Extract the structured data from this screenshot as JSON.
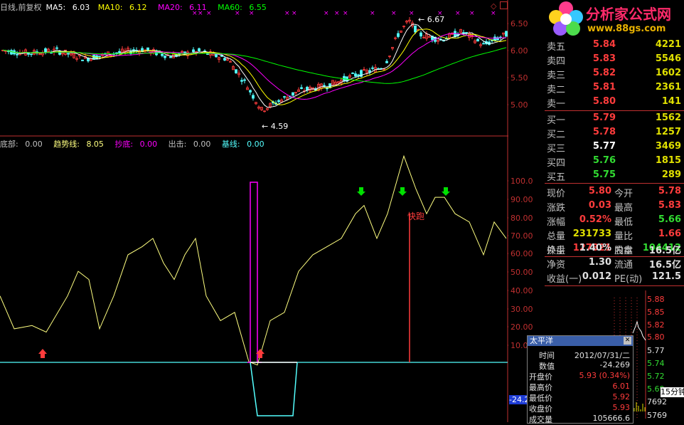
{
  "header": {
    "title": "日线,前复权",
    "ma5_label": "MA5:",
    "ma5": "6.03",
    "ma10_label": "MA10:",
    "ma10": "6.12",
    "ma20_label": "MA20:",
    "ma20": "6.11",
    "ma60_label": "MA60:",
    "ma60": "6.55"
  },
  "price_axis": [
    "6.50",
    "6.00",
    "5.50",
    "5.00"
  ],
  "price_annotations": {
    "high": "6.67",
    "low": "4.59"
  },
  "indicator": {
    "bottom_label": "底部:",
    "bottom": "0.00",
    "trend_label": "趋势线:",
    "trend": "8.05",
    "buy_label": "抄底:",
    "buy": "0.00",
    "sell_label": "出击:",
    "sell": "0.00",
    "base_label": "基线:",
    "base": "0.00",
    "axis": [
      "100.0",
      "90.00",
      "80.00",
      "70.00",
      "60.00",
      "50.00",
      "40.00",
      "30.00",
      "20.00",
      "10.00"
    ],
    "escape_label": "快跑",
    "cursor_value": "-24.2"
  },
  "quote": {
    "asks": [
      {
        "label": "卖五",
        "price": "5.84",
        "vol": "4221"
      },
      {
        "label": "卖四",
        "price": "5.83",
        "vol": "5546"
      },
      {
        "label": "卖三",
        "price": "5.82",
        "vol": "1602"
      },
      {
        "label": "卖二",
        "price": "5.81",
        "vol": "2361"
      },
      {
        "label": "卖一",
        "price": "5.80",
        "vol": "141"
      }
    ],
    "bids": [
      {
        "label": "买一",
        "price": "5.79",
        "vol": "1562"
      },
      {
        "label": "买二",
        "price": "5.78",
        "vol": "1257"
      },
      {
        "label": "买三",
        "price": "5.77",
        "vol": "3469"
      },
      {
        "label": "买四",
        "price": "5.76",
        "vol": "1815"
      },
      {
        "label": "买五",
        "price": "5.75",
        "vol": "289"
      }
    ],
    "info": [
      {
        "l1": "现价",
        "v1": "5.80",
        "l2": "今开",
        "v2": "5.78"
      },
      {
        "l1": "涨跌",
        "v1": "0.03",
        "l2": "最高",
        "v2": "5.83"
      },
      {
        "l1": "涨幅",
        "v1": "0.52%",
        "l2": "最低",
        "v2": "5.66"
      },
      {
        "l1": "总量",
        "v1": "231733",
        "l2": "量比",
        "v2": "1.66"
      },
      {
        "l1": "外盘",
        "v1": "127321",
        "l2": "内盘",
        "v2": "104412"
      }
    ],
    "info2": [
      {
        "l1": "换手",
        "v1": "1.40%",
        "l2": "股本",
        "v2": "16.5亿"
      },
      {
        "l1": "净资",
        "v1": "1.30",
        "l2": "流通",
        "v2": "16.5亿"
      },
      {
        "l1": "收益(一)",
        "v1": "0.012",
        "l2": "PE(动)",
        "v2": "121.5"
      }
    ]
  },
  "logo": {
    "name": "分析家公式网",
    "url": "www.88gs.com"
  },
  "mini_ticks": [
    "5.88",
    "5.85",
    "5.82",
    "5.80",
    "5.77",
    "5.74",
    "5.72",
    "5.69",
    "7692",
    "5769"
  ],
  "mini_label": "15分钟",
  "popup": {
    "title": "太平洋",
    "rows": [
      {
        "label": "时间",
        "value": "2012/07/31/二"
      },
      {
        "label": "数值",
        "value": "-24.269"
      },
      {
        "label": "开盘价",
        "value": "5.93 (0.34%)"
      },
      {
        "label": "最高价",
        "value": "6.01"
      },
      {
        "label": "最低价",
        "value": "5.92"
      },
      {
        "label": "收盘价",
        "value": "5.93"
      },
      {
        "label": "成交量",
        "value": "105666.6"
      }
    ]
  },
  "colors": {
    "up": "#ff3c3c",
    "down": "#54ffff",
    "ma5": "#ffffff",
    "ma10": "#ffff00",
    "ma20": "#ff00ff",
    "ma60": "#00ff00",
    "trend": "#ffff80",
    "bottom_mark": "#ff00ff",
    "base": "#54ffff"
  }
}
